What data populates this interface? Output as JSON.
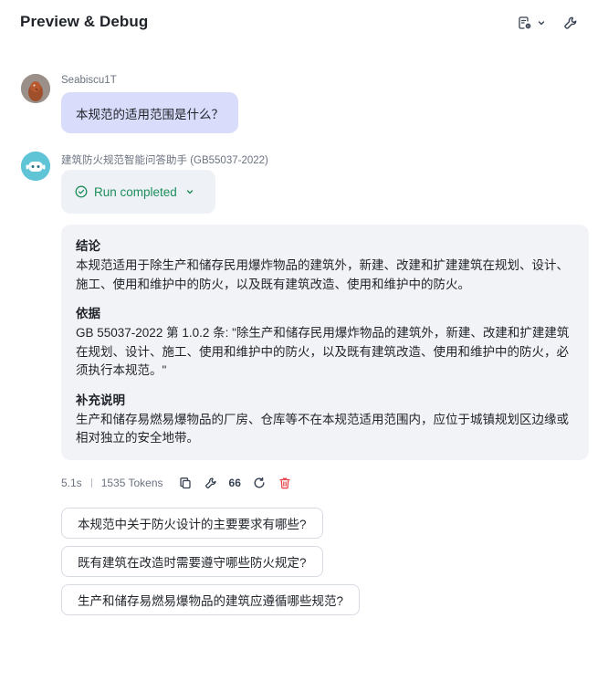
{
  "header": {
    "title": "Preview & Debug"
  },
  "user_message": {
    "sender": "Seabiscu1T",
    "text": "本规范的适用范围是什么？"
  },
  "bot_message": {
    "sender": "建筑防火规范智能问答助手 (GB55037-2022)",
    "run_status": "Run completed",
    "sections": [
      {
        "title": "结论",
        "body": "本规范适用于除生产和储存民用爆炸物品的建筑外，新建、改建和扩建建筑在规划、设计、施工、使用和维护中的防火，以及既有建筑改造、使用和维护中的防火。"
      },
      {
        "title": "依据",
        "body": "GB 55037-2022 第 1.0.2 条: \"除生产和储存民用爆炸物品的建筑外，新建、改建和扩建建筑在规划、设计、施工、使用和维护中的防火，以及既有建筑改造、使用和维护中的防火，必须执行本规范。\""
      },
      {
        "title": "补充说明",
        "body": "生产和储存易燃易爆物品的厂房、仓库等不在本规范适用范围内，应位于城镇规划区边缘或相对独立的安全地带。"
      }
    ],
    "meta": {
      "time": "5.1s",
      "tokens": "1535 Tokens",
      "quote_label": "66"
    }
  },
  "suggestions": [
    "本规范中关于防火设计的主要要求有哪些?",
    "既有建筑在改造时需要遵守哪些防火规定?",
    "生产和储存易燃易爆物品的建筑应遵循哪些规范?"
  ],
  "colors": {
    "user_bubble": "#d9dcfa",
    "answer_bg": "#f2f3f6",
    "run_success": "#1e8e5a",
    "delete_red": "#e5484d"
  }
}
